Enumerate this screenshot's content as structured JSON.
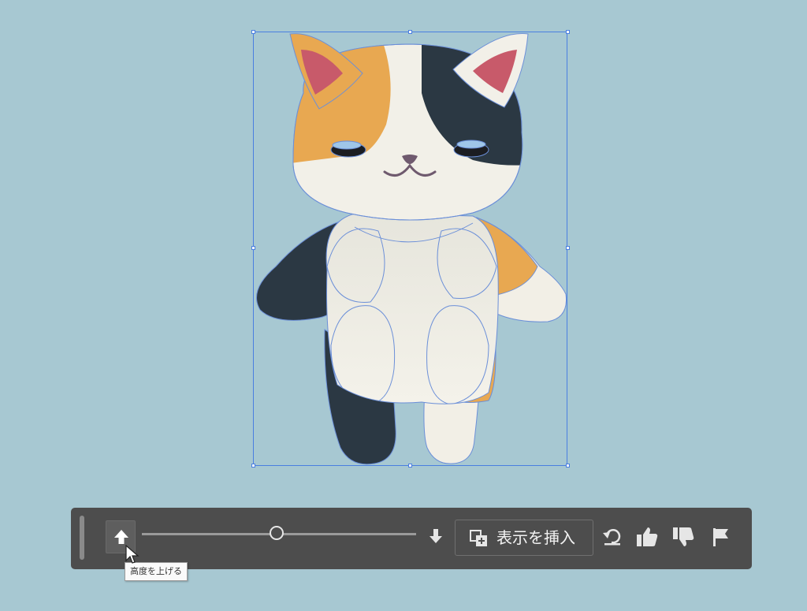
{
  "canvas": {
    "background": "#a7c8d2",
    "illustration": "calico-cat-character",
    "selection_color": "#4a7fe0"
  },
  "toolbar": {
    "background": "#4d4d4d",
    "raise_height_icon": "arrow-up-icon",
    "lower_height_icon": "arrow-down-icon",
    "insert_view_label": "表示を挿入",
    "insert_view_icon": "insert-view-icon",
    "undo_icon": "undo-icon",
    "thumbs_up_icon": "thumbs-up-icon",
    "thumbs_down_icon": "thumbs-down-icon",
    "flag_icon": "flag-icon"
  },
  "tooltip": {
    "text": "高度を上げる"
  }
}
